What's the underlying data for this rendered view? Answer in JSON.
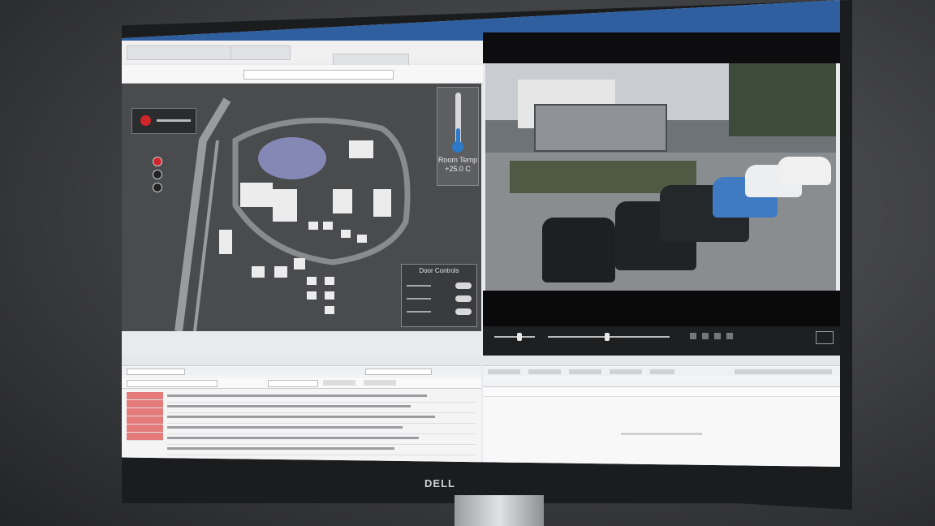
{
  "map_panel": {
    "temperature_widget": {
      "label": "Room Temp",
      "value": "+25.0 C"
    },
    "door_controls": {
      "title": "Door Controls"
    }
  },
  "monitor": {
    "brand": "DELL"
  },
  "colors": {
    "alarm_red": "#d0262b",
    "thermo_blue": "#2c7ac9",
    "title_blue": "#2f5f9f"
  }
}
